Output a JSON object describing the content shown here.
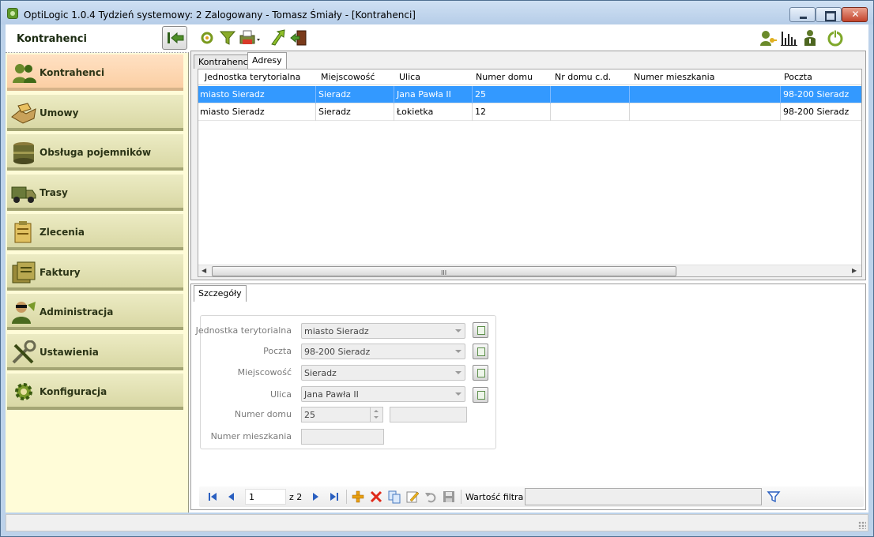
{
  "window": {
    "title": "OptiLogic 1.0.4  Tydzień systemowy: 2  Zalogowany - Tomasz Śmiały - [Kontrahenci]",
    "close_glyph": "✕"
  },
  "nav": {
    "title": "Kontrahenci",
    "items": [
      {
        "label": "Kontrahenci",
        "icon": "people-icon",
        "active": true
      },
      {
        "label": "Umowy",
        "icon": "handshake-icon"
      },
      {
        "label": "Obsługa pojemników",
        "icon": "container-icon"
      },
      {
        "label": "Trasy",
        "icon": "truck-icon"
      },
      {
        "label": "Zlecenia",
        "icon": "clipboard-icon"
      },
      {
        "label": "Faktury",
        "icon": "invoice-icon"
      },
      {
        "label": "Administracja",
        "icon": "admin-user-icon"
      },
      {
        "label": "Ustawienia",
        "icon": "tools-icon"
      },
      {
        "label": "Konfiguracja",
        "icon": "config-gear-icon"
      }
    ]
  },
  "toolbar": {
    "left": [
      "refresh-icon",
      "filter-icon",
      "print-icon",
      "export-icon",
      "exit-door-icon"
    ],
    "right": [
      "user-key-icon",
      "chart-icon",
      "user-info-icon",
      "power-icon"
    ]
  },
  "top_tabs": [
    {
      "label": "Kontrahenci",
      "active": false
    },
    {
      "label": "Adresy",
      "active": true
    }
  ],
  "grid": {
    "columns": [
      "Jednostka terytorialna",
      "Miejscowość",
      "Ulica",
      "Numer domu",
      "Nr domu c.d.",
      "Numer mieszkania",
      "Poczta"
    ],
    "rows": [
      {
        "cells": [
          "miasto Sieradz",
          "Sieradz",
          "Jana Pawła II",
          "25",
          "",
          "",
          "98-200 Sieradz"
        ],
        "selected": true
      },
      {
        "cells": [
          "miasto Sieradz",
          "Sieradz",
          "Łokietka",
          "12",
          "",
          "",
          "98-200 Sieradz"
        ],
        "selected": false
      }
    ],
    "scroll_grip": "III"
  },
  "bottom_tabs": [
    {
      "label": "Szczegóły",
      "active": true
    }
  ],
  "details": {
    "fields": [
      {
        "label": "Jednostka terytorialna",
        "value": "miasto Sieradz"
      },
      {
        "label": "Poczta",
        "value": "98-200 Sieradz"
      },
      {
        "label": "Miejscowość",
        "value": "Sieradz"
      },
      {
        "label": "Ulica",
        "value": "Jana Pawła II"
      }
    ],
    "numer_domu_label": "Numer domu",
    "numer_domu_value": "25",
    "nr_domu_cd_value": "",
    "numer_mieszkania_label": "Numer mieszkania",
    "numer_mieszkania_value": ""
  },
  "navigator": {
    "page": "1",
    "of_text": "z 2",
    "filter_label": "Wartość filtra",
    "filter_value": ""
  }
}
